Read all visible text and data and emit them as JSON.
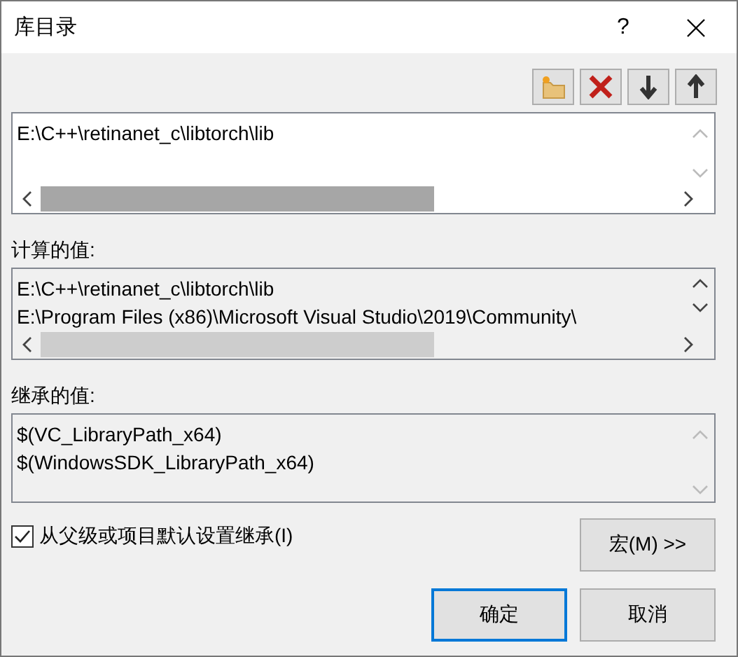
{
  "window": {
    "title": "库目录",
    "help": "?"
  },
  "directories": {
    "entries": [
      "E:\\C++\\retinanet_c\\libtorch\\lib"
    ]
  },
  "computed": {
    "label": "计算的值:",
    "lines": [
      "E:\\C++\\retinanet_c\\libtorch\\lib",
      "E:\\Program Files (x86)\\Microsoft Visual Studio\\2019\\Community\\"
    ]
  },
  "inherited": {
    "label": "继承的值:",
    "lines": [
      "$(VC_LibraryPath_x64)",
      "$(WindowsSDK_LibraryPath_x64)"
    ]
  },
  "inherit_checkbox": {
    "label": "从父级或项目默认设置继承(I)",
    "checked": true
  },
  "macro_button": "宏(M) >>",
  "buttons": [
    {
      "label": "确定",
      "default": true
    },
    {
      "label": "取消",
      "default": false
    }
  ]
}
